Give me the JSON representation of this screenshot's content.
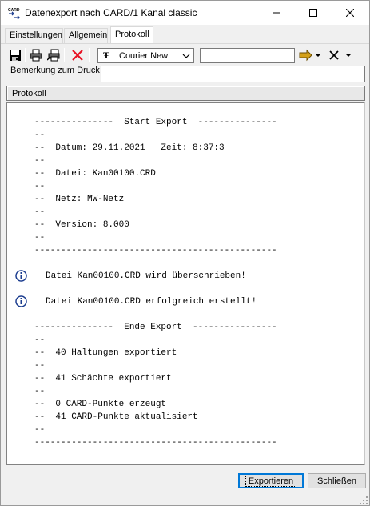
{
  "window": {
    "title": "Datenexport nach CARD/1 Kanal classic",
    "app_icon_text": "CARD"
  },
  "tabs": [
    {
      "label": "Einstellungen"
    },
    {
      "label": "Allgemein"
    },
    {
      "label": "Protokoll",
      "active": true
    }
  ],
  "toolbar": {
    "font_name": "Courier New",
    "font_size_value": "",
    "icons": [
      "save-icon",
      "print-icon",
      "print-setup-icon",
      "delete-icon",
      "truetype-icon",
      "arrow-right-icon",
      "clear-icon"
    ]
  },
  "remark": {
    "label": "Bemerkung zum Druck",
    "value": ""
  },
  "protocol": {
    "header": "Protokoll",
    "lines": [
      "---------------  Start Export  ---------------",
      "--",
      "--  Datum: 29.11.2021   Zeit: 8:37:3",
      "--",
      "--  Datei: Kan00100.CRD",
      "--",
      "--  Netz: MW-Netz",
      "--",
      "--  Version: 8.000",
      "--",
      "----------------------------------------------"
    ],
    "messages": [
      "Datei Kan00100.CRD wird überschrieben!",
      "Datei Kan00100.CRD erfolgreich erstellt!"
    ],
    "end_lines": [
      "---------------  Ende Export  ----------------",
      "--",
      "--  40 Haltungen exportiert",
      "--",
      "--  41 Schächte exportiert",
      "--",
      "--  0 CARD-Punkte erzeugt",
      "--  41 CARD-Punkte aktualisiert",
      "--",
      "----------------------------------------------"
    ]
  },
  "buttons": {
    "export": "Exportieren",
    "close": "Schließen"
  },
  "colors": {
    "delete_red": "#e81123",
    "info_blue": "#1c3d8f",
    "focus_blue": "#0078d7"
  }
}
